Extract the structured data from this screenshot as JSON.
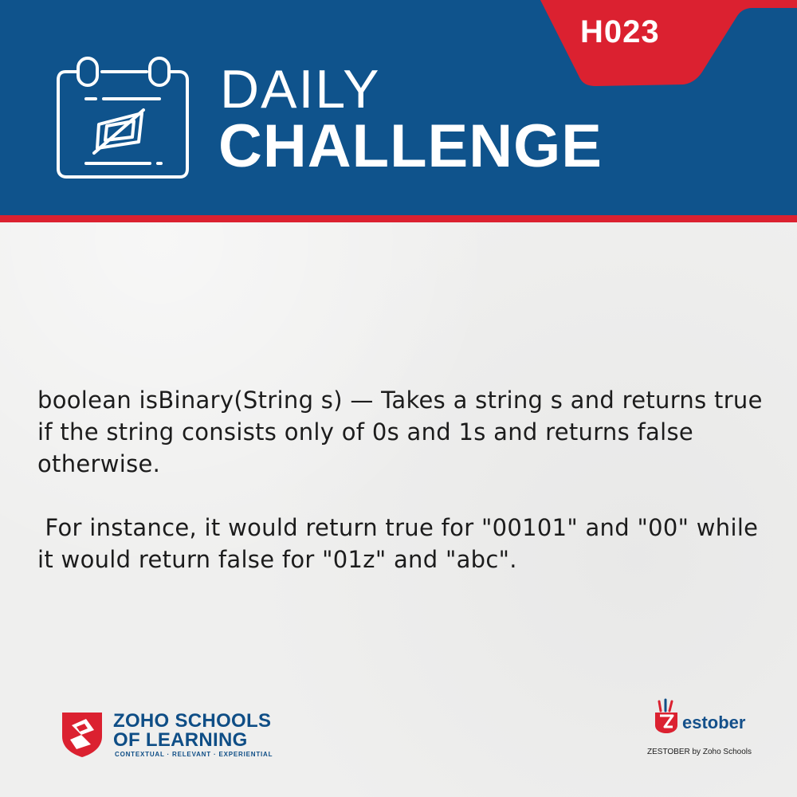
{
  "header": {
    "code": "H023",
    "title_line1": "DAILY",
    "title_line2": "CHALLENGE",
    "icon": "calendar-icon"
  },
  "colors": {
    "header_blue": "#0f538c",
    "accent_red": "#db2130",
    "background": "#efefee"
  },
  "challenge": {
    "paragraph1": "boolean isBinary(String s) — Takes a string s and returns true if the string consists only of 0s and 1s and returns false otherwise.",
    "paragraph2": "For instance, it would return true for \"00101\" and \"00\" while it would return false for \"01z\" and \"abc\"."
  },
  "footer": {
    "zoho_line1": "ZOHO SCHOOLS",
    "zoho_line2": "OF LEARNING",
    "zoho_tagline": "CONTEXTUAL · RELEVANT · EXPERIENTIAL",
    "zestober_word": "estober",
    "zestober_caption": "ZESTOBER by Zoho Schools"
  }
}
